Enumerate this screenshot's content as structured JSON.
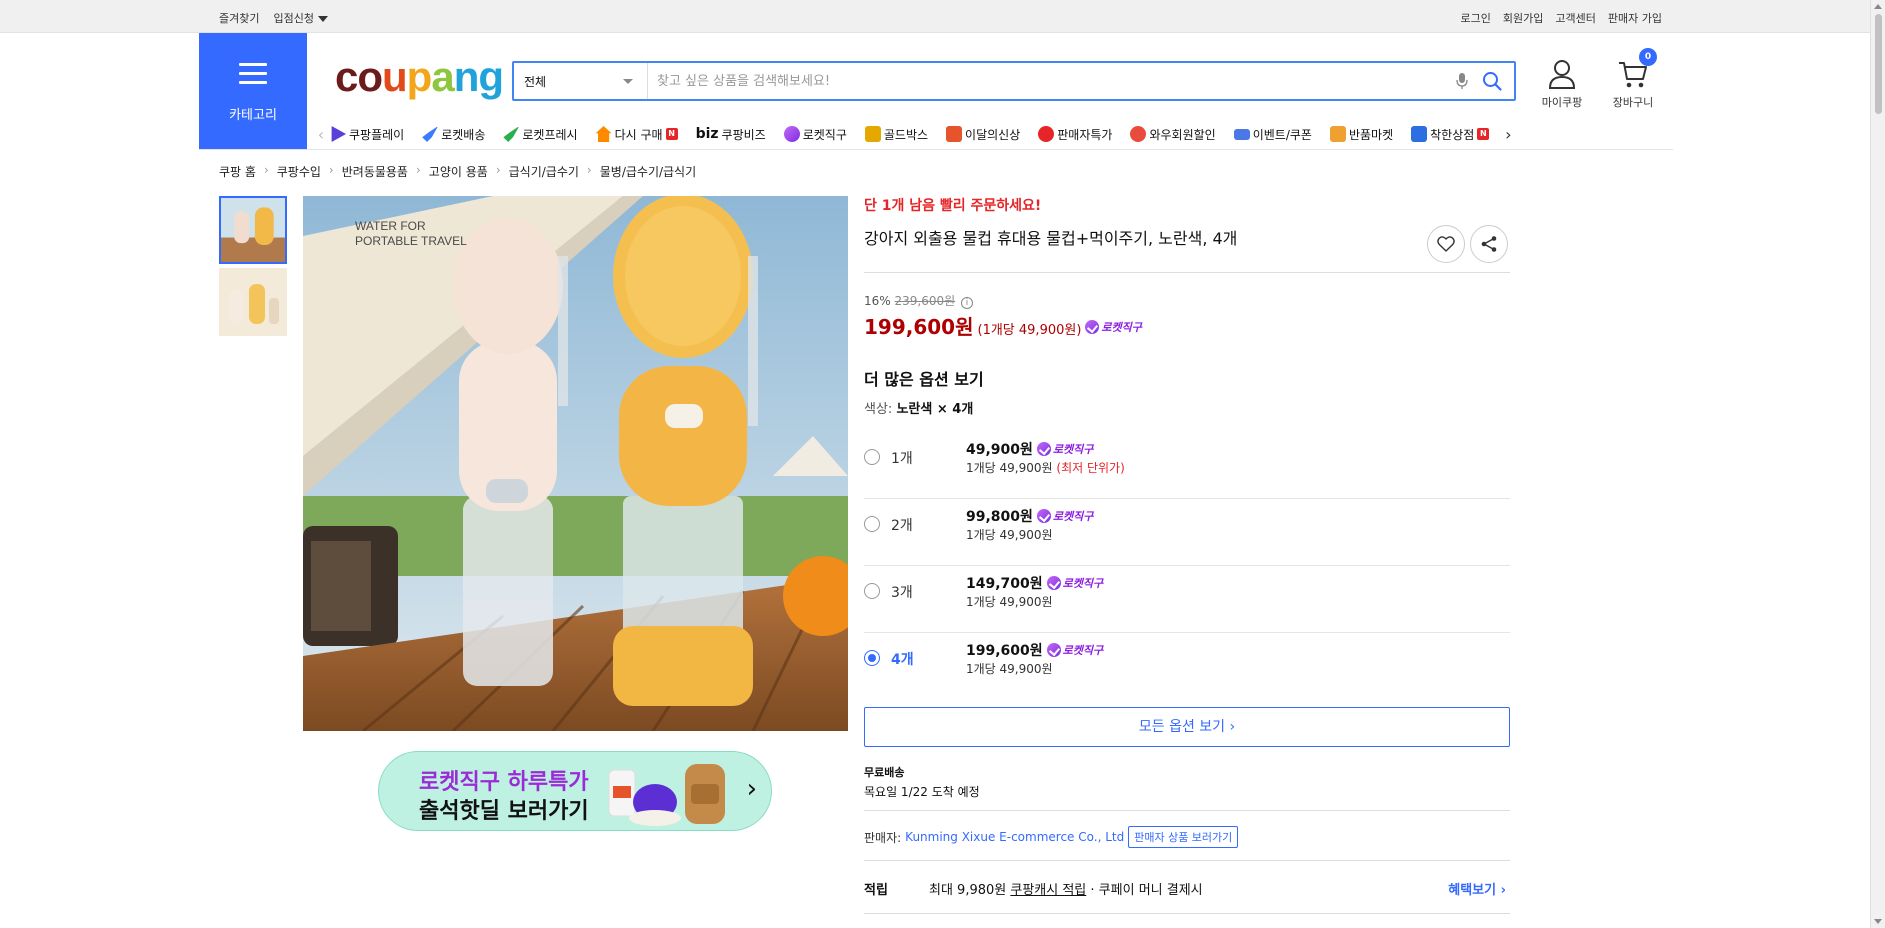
{
  "topbar": {
    "left": [
      "즐겨찾기",
      "입점신청"
    ],
    "right": [
      "로그인",
      "회원가입",
      "고객센터",
      "판매자 가입"
    ]
  },
  "header": {
    "category_label": "카테고리",
    "logo": [
      "co",
      "u",
      "p",
      "a",
      "ng"
    ],
    "search_category": "전체",
    "search_placeholder": "찾고 싶은 상품을 검색해보세요!",
    "mypage_label": "마이쿠팡",
    "cart_label": "장바구니",
    "cart_count": "0"
  },
  "nav": [
    {
      "label": "쿠팡플레이",
      "icon": "play-icon",
      "color": "#5a3fd8"
    },
    {
      "label": "로켓배송",
      "icon": "rocket-icon",
      "color": "#3a7bff"
    },
    {
      "label": "로켓프레시",
      "icon": "rocket-fresh-icon",
      "color": "#29b04a"
    },
    {
      "label": "다시 구매",
      "icon": "home-repurchase-icon",
      "color": "#ff8a00",
      "new": true
    },
    {
      "label": "쿠팡비즈",
      "icon": "biz-icon",
      "color": "#111"
    },
    {
      "label": "로켓직구",
      "icon": "rocket-global-icon",
      "color": "#a24be8"
    },
    {
      "label": "골드박스",
      "icon": "goldbox-icon",
      "color": "#e5a800"
    },
    {
      "label": "이달의신상",
      "icon": "bag-icon",
      "color": "#e5542a"
    },
    {
      "label": "판매자특가",
      "icon": "percent-icon",
      "color": "#e52528"
    },
    {
      "label": "와우회원할인",
      "icon": "wow-icon",
      "color": "#e74c3c"
    },
    {
      "label": "이벤트/쿠폰",
      "icon": "coupon-icon",
      "color": "#4a78e6"
    },
    {
      "label": "반품마켓",
      "icon": "market-icon",
      "color": "#f0a030"
    },
    {
      "label": "착한상점",
      "icon": "store-icon",
      "color": "#2b6fe0",
      "new": true
    }
  ],
  "nav_new_badge": "N",
  "nav_biz_prefix": "biz",
  "breadcrumb": [
    "쿠팡 홈",
    "쿠팡수입",
    "반려동물용품",
    "고양이 용품",
    "급식기/급수기",
    "물병/급수기/급식기"
  ],
  "gallery": {
    "main_caption": [
      "WATER FOR",
      "PORTABLE TRAVEL"
    ]
  },
  "banner": {
    "line1": "로켓직구 하루특가",
    "line2": "출석핫딜 보러가기"
  },
  "product": {
    "urgent": "단 1개 남음 빨리 주문하세요!",
    "title": "강아지 외출용 물컵 휴대용 물컵+먹이주기, 노란색, 4개",
    "discount": "16%",
    "original_price": "239,600원",
    "price": "199,600원",
    "unit_price": "(1개당 49,900원)",
    "rocket_label": "로켓직구",
    "options_heading": "더 많은 옵션 보기",
    "color_label": "색상:",
    "color_value": "노란색 × 4개",
    "options": [
      {
        "qty": "1개",
        "price": "49,900원",
        "sub": "1개당 49,900원",
        "highlight": "(최저 단위가)",
        "selected": false
      },
      {
        "qty": "2개",
        "price": "99,800원",
        "sub": "1개당 49,900원",
        "highlight": "",
        "selected": false
      },
      {
        "qty": "3개",
        "price": "149,700원",
        "sub": "1개당 49,900원",
        "highlight": "",
        "selected": false
      },
      {
        "qty": "4개",
        "price": "199,600원",
        "sub": "1개당 49,900원",
        "highlight": "",
        "selected": true
      }
    ],
    "all_options_label": "모든 옵션 보기 ›",
    "shipping_title": "무료배송",
    "shipping_date": "목요일 1/22 도착 예정",
    "seller_label": "판매자:",
    "seller_name": "Kunming Xixue E-commerce Co., Ltd",
    "seller_button": "판매자 상품 보러가기",
    "points_label": "적립",
    "points_text_1": "최대 9,980원",
    "points_link": "쿠팡캐시 적립",
    "points_text_2": "· 쿠페이 머니 결제시",
    "points_more": "혜택보기 ›"
  }
}
